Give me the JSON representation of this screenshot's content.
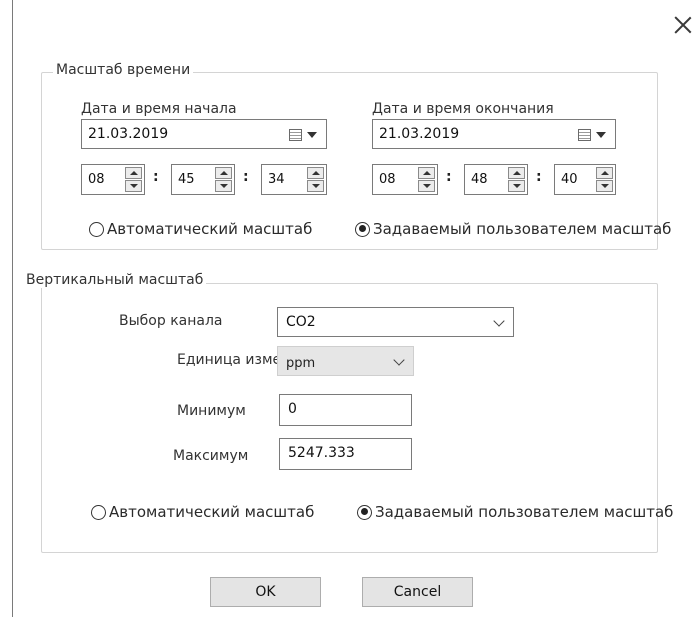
{
  "dialog": {
    "close_icon": "close-icon"
  },
  "time_scale": {
    "legend": "Масштаб времени",
    "start": {
      "label": "Дата и время начала",
      "date": "21.03.2019",
      "hours": "08",
      "minutes": "45",
      "seconds": "34"
    },
    "end": {
      "label": "Дата и время окончания",
      "date": "21.03.2019",
      "hours": "08",
      "minutes": "48",
      "seconds": "40"
    },
    "time_separator": ":",
    "radio_auto": "Автоматический масштаб",
    "radio_user": "Задаваемый пользователем масштаб",
    "selected": "user"
  },
  "vertical_scale": {
    "legend": "Вертикальный масштаб",
    "channel_label": "Выбор канала",
    "channel_value": "CO2",
    "unit_label": "Единица измерения",
    "unit_value": "ppm",
    "min_label": "Минимум",
    "min_value": "0",
    "max_label": "Максимум",
    "max_value": "5247.333",
    "radio_auto": "Автоматический масштаб",
    "radio_user": "Задаваемый пользователем масштаб",
    "selected": "user"
  },
  "buttons": {
    "ok": "OK",
    "cancel": "Cancel"
  }
}
